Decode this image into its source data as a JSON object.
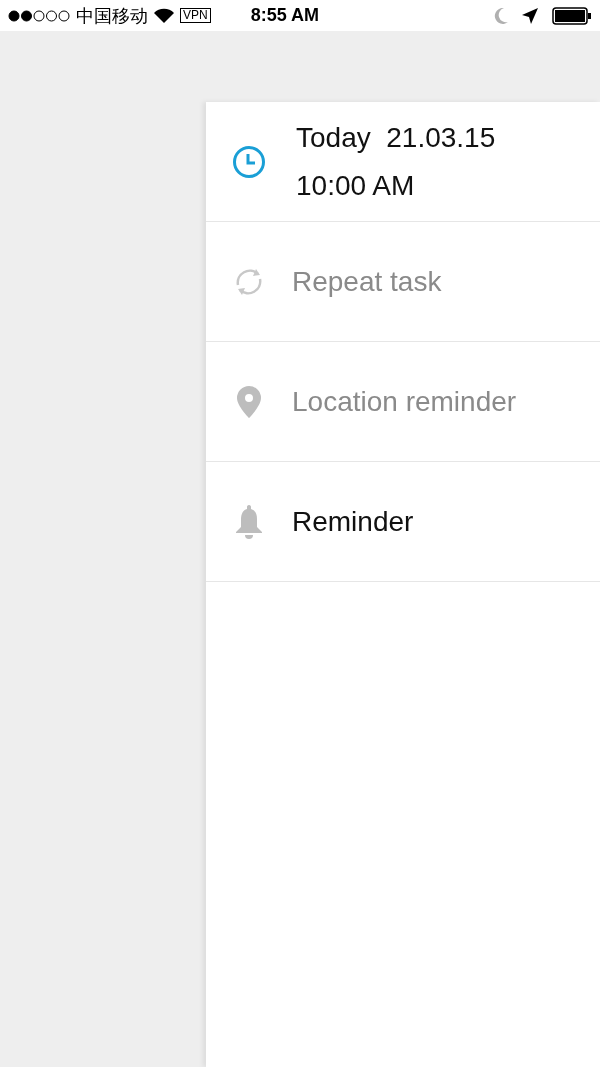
{
  "status_bar": {
    "carrier": "中国移动",
    "vpn": "VPN",
    "time": "8:55 AM"
  },
  "options": [
    {
      "kind": "time",
      "set": true,
      "lines": [
        "Today  21.03.15",
        "10:00 AM"
      ]
    },
    {
      "kind": "repeat",
      "set": false,
      "lines": [
        "Repeat task"
      ]
    },
    {
      "kind": "location",
      "set": false,
      "lines": [
        "Location reminder"
      ]
    },
    {
      "kind": "reminder",
      "set": true,
      "lines": [
        "Reminder"
      ]
    }
  ]
}
